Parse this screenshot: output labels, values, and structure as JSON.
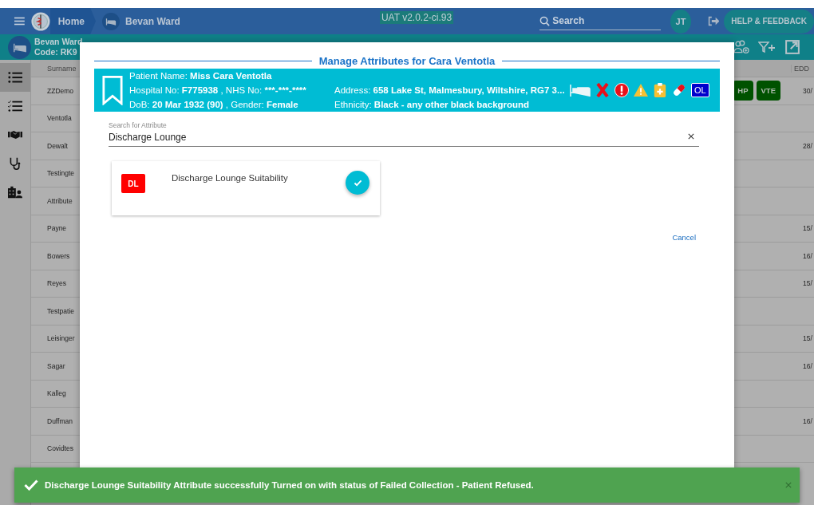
{
  "top_bar": {
    "home": "Home",
    "ward": "Bevan Ward",
    "version": "UAT v2.0.2-ci.93",
    "search_placeholder": "Search",
    "user_initials": "JT",
    "help_button": "HELP & FEEDBACK"
  },
  "ward_bar": {
    "name": "Bevan Ward",
    "code": "Code: RK9"
  },
  "sidebar": {
    "items": [
      {
        "kind": "list",
        "selected": true
      },
      {
        "kind": "checklist",
        "selected": false
      },
      {
        "kind": "handshake",
        "selected": false
      },
      {
        "kind": "stethoscope",
        "selected": false
      },
      {
        "kind": "building",
        "selected": false
      }
    ]
  },
  "table": {
    "columns": [
      "Surname",
      "EDD"
    ],
    "rows": [
      {
        "surname": "ZZDemo",
        "badges": [
          "HP",
          "VTE"
        ],
        "edd": "30/"
      },
      {
        "surname": "Ventotla",
        "badges": [],
        "edd": ""
      },
      {
        "surname": "Dewalt",
        "badges": [],
        "edd": "28/"
      },
      {
        "surname": "Testingte",
        "badges": [],
        "edd": ""
      },
      {
        "surname": "Attribute",
        "badges": [],
        "edd": ""
      },
      {
        "surname": "Payne",
        "badges": [],
        "edd": "15/"
      },
      {
        "surname": "Bowers",
        "badges": [],
        "edd": "16/"
      },
      {
        "surname": "Reyes",
        "badges": [],
        "edd": "15/"
      },
      {
        "surname": "Testpatie",
        "badges": [],
        "edd": ""
      },
      {
        "surname": "Leisinger",
        "badges": [],
        "edd": "15/"
      },
      {
        "surname": "Sagar",
        "badges": [],
        "edd": "16/"
      },
      {
        "surname": "Kalleg",
        "badges": [],
        "edd": ""
      },
      {
        "surname": "Duffman",
        "badges": [],
        "edd": "16/"
      },
      {
        "surname": "Covidtes",
        "badges": [],
        "edd": ""
      }
    ]
  },
  "dialog": {
    "title": "Manage Attributes for Cara Ventotla",
    "patient": {
      "name_label": "Patient Name: ",
      "name": "Miss Cara Ventotla",
      "hospital_label": "Hospital No: ",
      "hospital_no": "F775938",
      "nhs_label": " , NHS No: ",
      "nhs_no": "***-***-****",
      "line3": "DoB: **20 Mar 1932 (90)** , Gender: **Female**",
      "address": "Address: **658 Lake St, Malmesbury, Wiltshire, RG7 3...**",
      "ethnicity": "Ethnicity: **Black - any other black background**",
      "flags": [
        {
          "kind": "bed"
        },
        {
          "kind": "cross"
        },
        {
          "kind": "alert"
        },
        {
          "kind": "warning"
        },
        {
          "kind": "clipboard"
        },
        {
          "kind": "pill"
        },
        {
          "kind": "text",
          "text": "OL"
        }
      ]
    },
    "search": {
      "label": "Search for Attribute",
      "value": "Discharge Lounge"
    },
    "results": [
      {
        "badge": "DL",
        "color": "#ff0000",
        "name": "Discharge Lounge Suitability",
        "checked": true
      }
    ],
    "cancel": "Cancel"
  },
  "toast": {
    "message": "Discharge Lounge Suitability Attribute successfully Turned on with status of Failed Collection - Patient Refused."
  }
}
